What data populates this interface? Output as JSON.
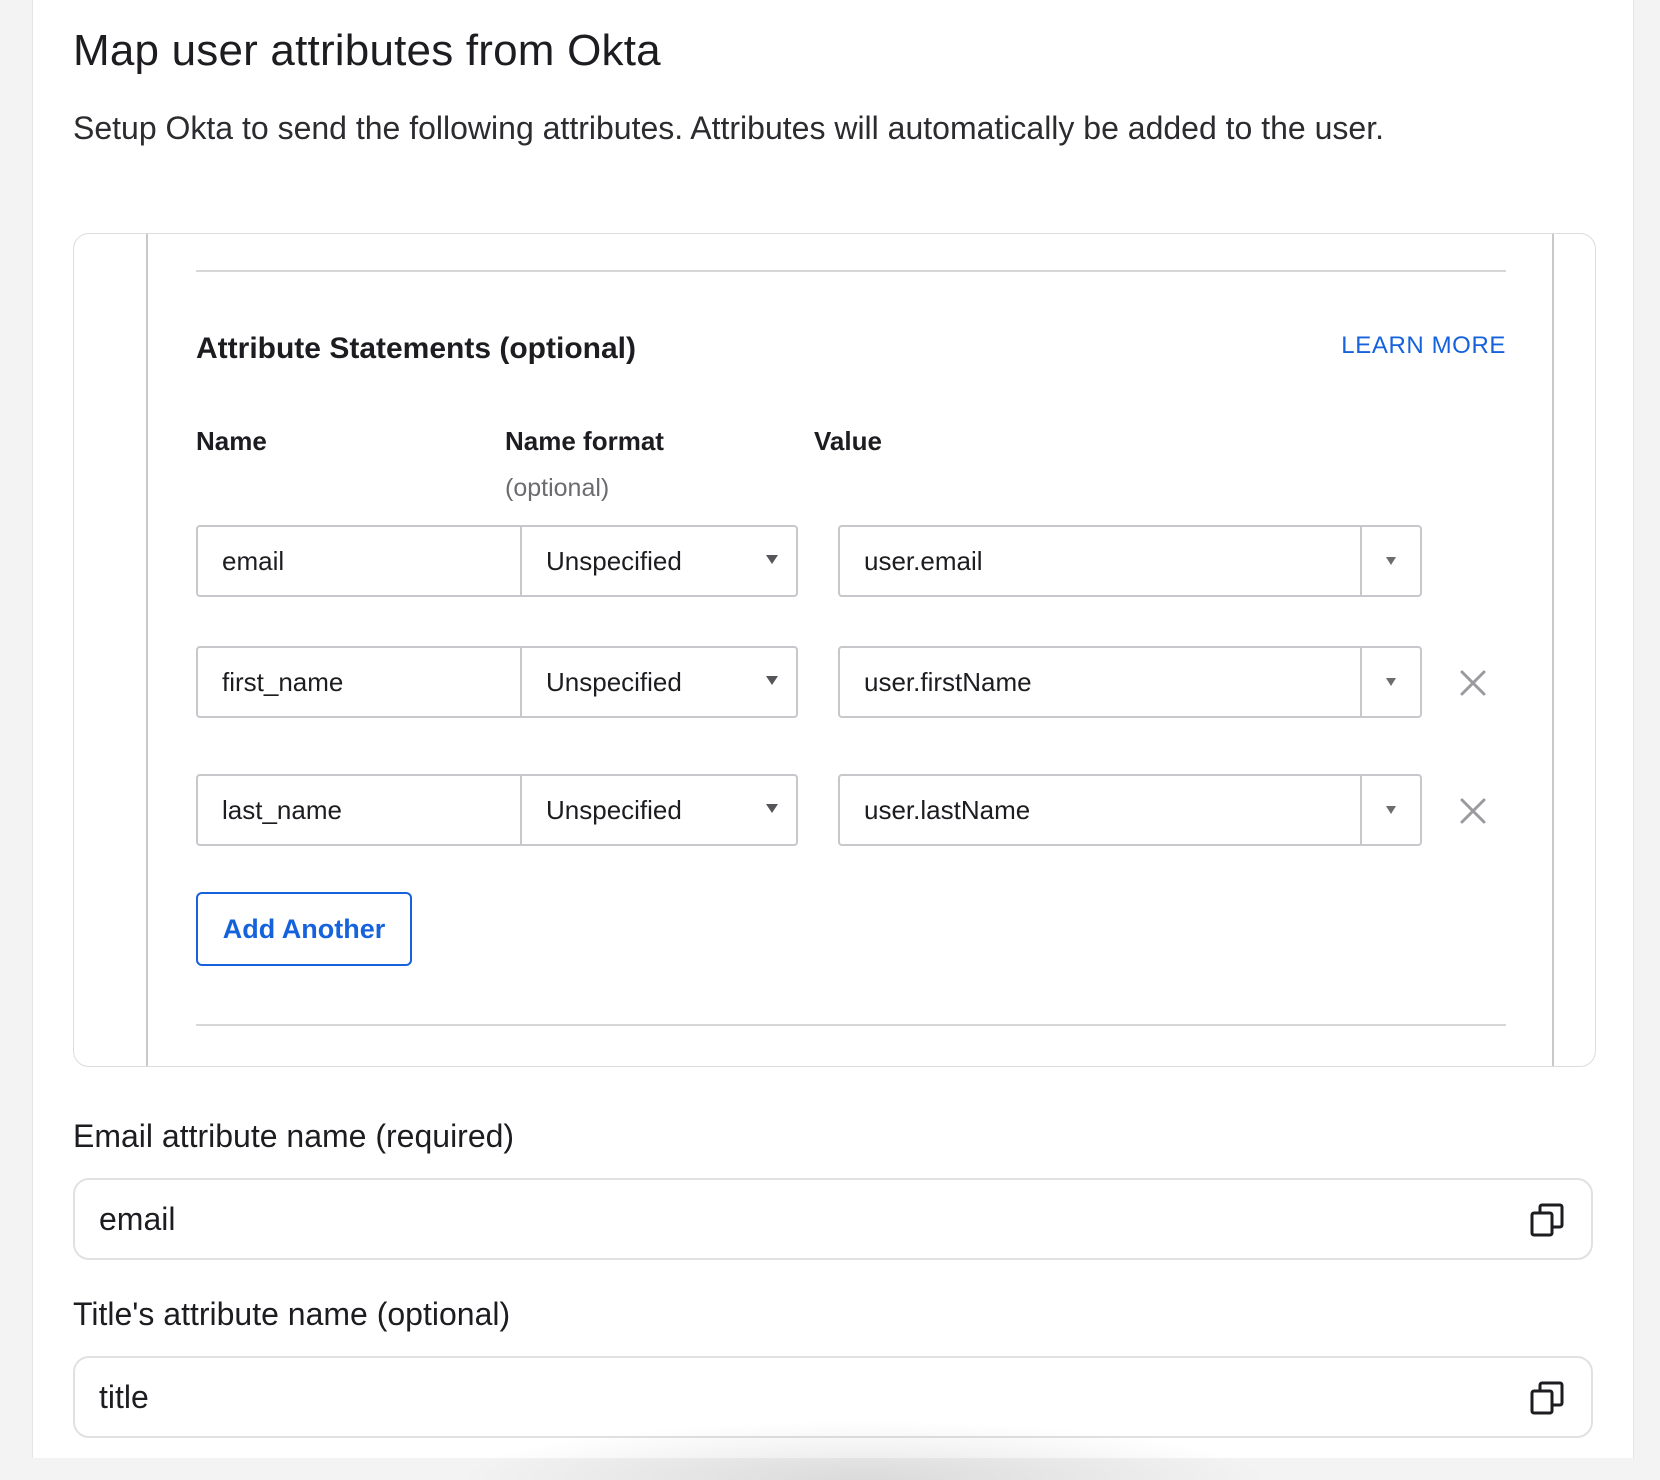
{
  "header": {
    "title": "Map user attributes from Okta",
    "subtitle": "Setup Okta to send the following attributes. Attributes will automatically be added to the user."
  },
  "attribute_statements": {
    "title": "Attribute Statements (optional)",
    "learn_more": "LEARN MORE",
    "columns": {
      "name": "Name",
      "name_format": "Name format",
      "name_format_sub": "(optional)",
      "value": "Value"
    },
    "rows": [
      {
        "name": "email",
        "format": "Unspecified",
        "value": "user.email",
        "removable": false
      },
      {
        "name": "first_name",
        "format": "Unspecified",
        "value": "user.firstName",
        "removable": true
      },
      {
        "name": "last_name",
        "format": "Unspecified",
        "value": "user.lastName",
        "removable": true
      }
    ],
    "add_button": "Add Another"
  },
  "email_attribute": {
    "label": "Email attribute name (required)",
    "value": "email"
  },
  "title_attribute": {
    "label": "Title's attribute name (optional)",
    "value": "title"
  },
  "colors": {
    "accent": "#1662dd",
    "border": "#c8c8cc",
    "text": "#1d1d21",
    "muted": "#6b6b70"
  },
  "icons": {
    "remove": "close-icon",
    "copy": "copy-icon",
    "dropdown": "chevron-down-icon"
  }
}
